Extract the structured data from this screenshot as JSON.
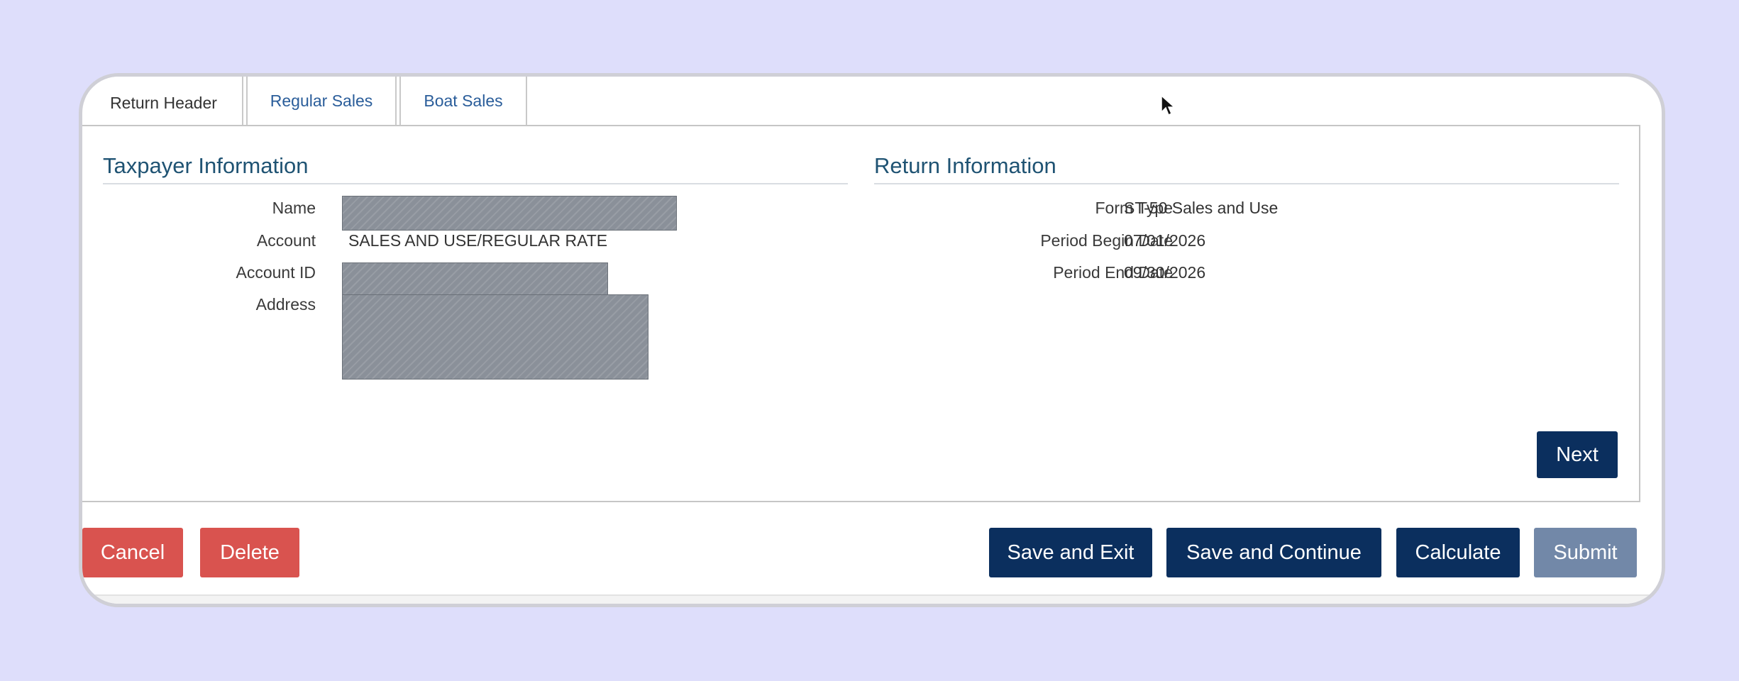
{
  "tabs": [
    {
      "label": "Return Header",
      "active": true
    },
    {
      "label": "Regular Sales",
      "active": false
    },
    {
      "label": "Boat Sales",
      "active": false
    }
  ],
  "taxpayer": {
    "title": "Taxpayer Information",
    "name_label": "Name",
    "account_label": "Account",
    "account_value": "SALES AND USE/REGULAR RATE",
    "account_id_label": "Account ID",
    "address_label": "Address"
  },
  "return_info": {
    "title": "Return Information",
    "form_type_label": "Form Type",
    "form_type_value": "ST-50 Sales and Use",
    "period_begin_label": "Period Begin Date",
    "period_begin_value": "07/01/2026",
    "period_end_label": "Period End Date",
    "period_end_value": "09/30/2026"
  },
  "buttons": {
    "next": "Next",
    "cancel": "Cancel",
    "delete": "Delete",
    "save_exit": "Save and Exit",
    "save_continue": "Save and Continue",
    "calculate": "Calculate",
    "submit": "Submit"
  },
  "colors": {
    "navy": "#0b2f5e",
    "red": "#d9534f",
    "disabled": "#7288a8",
    "link": "#2a5d9a",
    "heading": "#1f5373"
  },
  "icons": {
    "cursor": "mouse-pointer-icon"
  }
}
